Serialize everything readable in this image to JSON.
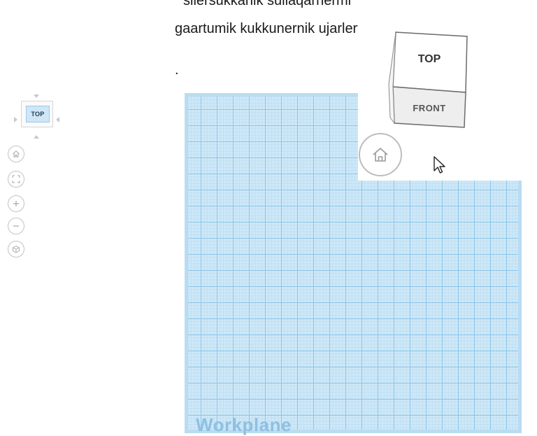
{
  "document": {
    "lines": [
      "siiersukkanik suliaqarnermi",
      "gaartumik kukkunernik ujarlertilluni.",
      "."
    ]
  },
  "nav_panel": {
    "mini_cube_face": "TOP",
    "buttons": [
      {
        "name": "home-view-button",
        "icon": "home-icon"
      },
      {
        "name": "fit-view-button",
        "icon": "fit-to-view-icon"
      },
      {
        "name": "zoom-in-button",
        "icon": "plus-icon"
      },
      {
        "name": "zoom-out-button",
        "icon": "minus-icon"
      },
      {
        "name": "perspective-button",
        "icon": "perspective-icon"
      }
    ]
  },
  "workplane": {
    "label": "Workplane"
  },
  "view_cube_zoom": {
    "top_label": "TOP",
    "front_label": "FRONT",
    "home_icon": "home-icon",
    "cursor_icon": "cursor-arrow-icon"
  },
  "colors": {
    "grid_major": "#8ec6ea",
    "grid_minor": "#bddff3",
    "workplane_bg": "#cfe8f7",
    "workplane_label": "#8fc0e2"
  }
}
